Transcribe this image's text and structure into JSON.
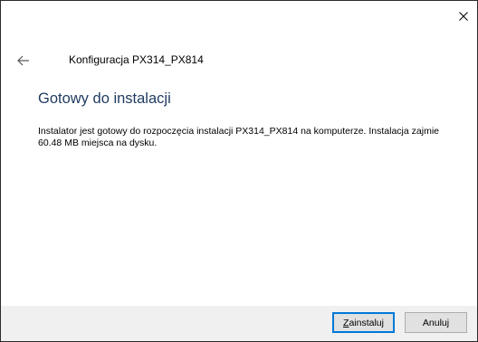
{
  "window": {
    "close_label": "×"
  },
  "nav": {
    "back_icon": "back-arrow-icon",
    "title": "Konfiguracja PX314_PX814"
  },
  "main": {
    "heading": "Gotowy do instalacji",
    "description": "Instalator jest gotowy do rozpoczęcia instalacji PX314_PX814 na komputerze. Instalacja zajmie 60.48 MB miejsca na dysku."
  },
  "footer": {
    "install_accel": "Z",
    "install_rest": "ainstaluj",
    "cancel_label": "Anuluj"
  },
  "colors": {
    "accent": "#0078d7",
    "heading": "#1e3a5f",
    "footer_bg": "#f0f0f0"
  }
}
